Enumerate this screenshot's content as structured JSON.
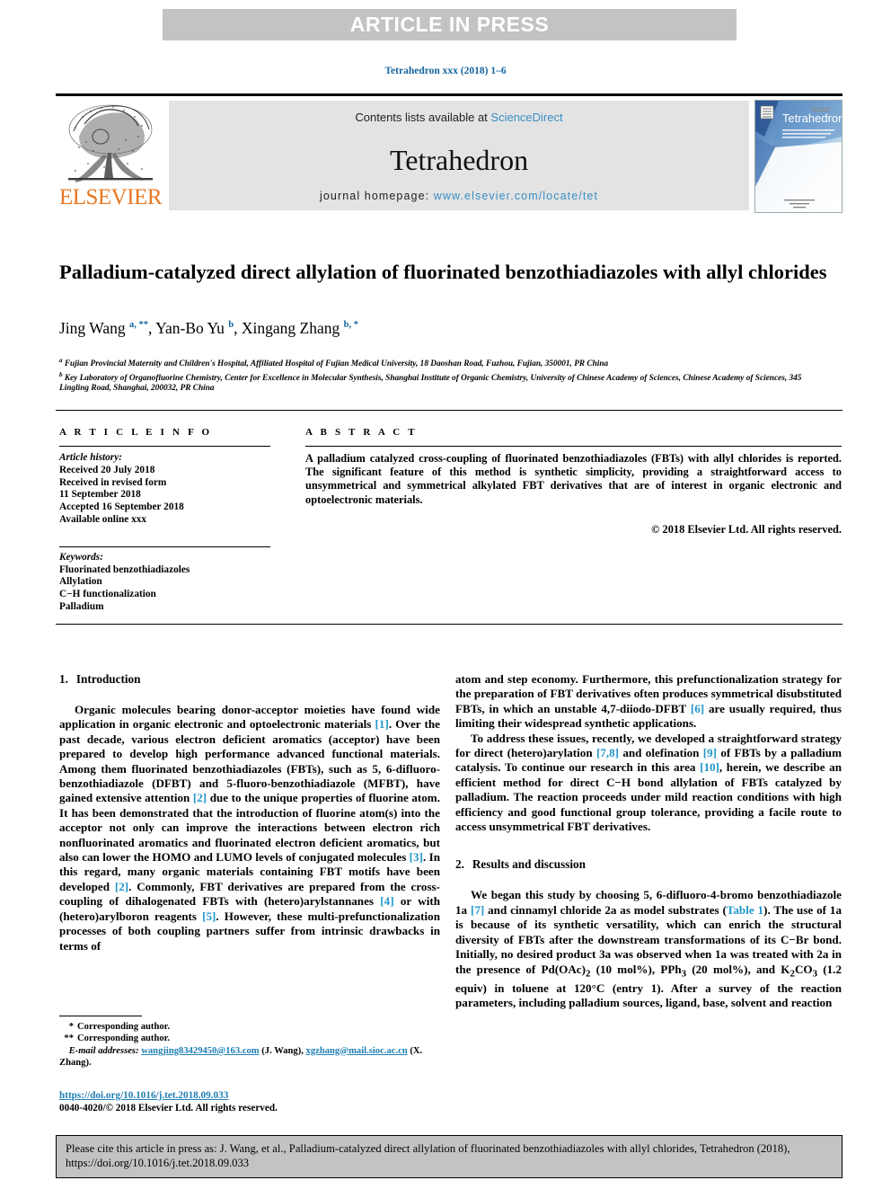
{
  "banner": {
    "text": "ARTICLE IN PRESS"
  },
  "journal_ref": "Tetrahedron xxx (2018) 1–6",
  "masthead": {
    "contents_prefix": "Contents lists available at ",
    "contents_link": "ScienceDirect",
    "journal_title": "Tetrahedron",
    "homepage_prefix": "journal homepage: ",
    "homepage_link": "www.elsevier.com/locate/tet",
    "publisher": "ELSEVIER",
    "cover_title": "Tetrahedron"
  },
  "article": {
    "title": "Palladium-catalyzed direct allylation of fluorinated benzothiadiazoles with allyl chlorides",
    "authors_html": "Jing Wang <sup>a, **</sup>, Yan-Bo Yu <sup>b</sup>, Xingang Zhang <sup>b, *</sup>",
    "affiliation_a": "Fujian Provincial Maternity and Children's Hospital, Affiliated Hospital of Fujian Medical University, 18 Daoshan Road, Fuzhou, Fujian, 350001, PR China",
    "affiliation_b": "Key Laboratory of Organofluorine Chemistry, Center for Excellence in Molecular Synthesis, Shanghai Institute of Organic Chemistry, University of Chinese Academy of Sciences, Chinese Academy of Sciences, 345 Lingling Road, Shanghai, 200032, PR China"
  },
  "article_info": {
    "heading": "A R T I C L E   I N F O",
    "history_label": "Article history:",
    "history_lines": [
      "Received 20 July 2018",
      "Received in revised form",
      "11 September 2018",
      "Accepted 16 September 2018",
      "Available online xxx"
    ],
    "keywords_label": "Keywords:",
    "keywords": [
      "Fluorinated benzothiadiazoles",
      "Allylation",
      "C−H functionalization",
      "Palladium"
    ]
  },
  "abstract": {
    "heading": "A B S T R A C T",
    "text": "A palladium catalyzed cross-coupling of fluorinated benzothiadiazoles (FBTs) with allyl chlorides is reported. The significant feature of this method is synthetic simplicity, providing a straightforward access to unsymmetrical and symmetrical alkylated FBT derivatives that are of interest in organic electronic and optoelectronic materials.",
    "copyright": "© 2018 Elsevier Ltd. All rights reserved."
  },
  "sections": {
    "intro_num": "1.",
    "intro_title": "Introduction",
    "results_num": "2.",
    "results_title": "Results and discussion"
  },
  "body": {
    "left_p1_a": "Organic molecules bearing donor-acceptor moieties have found wide application in organic electronic and optoelectronic materials ",
    "left_p1_r1": "[1]",
    "left_p1_b": ". Over the past decade, various electron deficient aromatics (acceptor) have been prepared to develop high performance advanced functional materials. Among them fluorinated benzothiadiazoles (FBTs), such as 5, 6-difluoro-benzothiadiazole (DFBT) and 5-fluoro-benzothiadiazole (MFBT), have gained extensive attention ",
    "left_p1_r2": "[2]",
    "left_p1_c": " due to the unique properties of fluorine atom. It has been demonstrated that the introduction of fluorine atom(s) into the acceptor not only can improve the interactions between electron rich nonfluorinated aromatics and fluorinated electron deficient aromatics, but also can lower the HOMO and LUMO levels of conjugated molecules ",
    "left_p1_r3": "[3]",
    "left_p1_d": ". In this regard, many organic materials containing FBT motifs have been developed ",
    "left_p1_r4": "[2]",
    "left_p1_e": ". Commonly, FBT derivatives are prepared from the cross-coupling of dihalogenated FBTs with (hetero)arylstannanes ",
    "left_p1_r5": "[4]",
    "left_p1_f": " or with (hetero)arylboron reagents ",
    "left_p1_r6": "[5]",
    "left_p1_g": ". However, these multi-prefunctionalization processes of both coupling partners suffer from intrinsic drawbacks in terms of",
    "right_p1_a": "atom and step economy. Furthermore, this prefunctionalization strategy for the preparation of FBT derivatives often produces symmetrical disubstituted FBTs, in which an unstable 4,7-diiodo-DFBT ",
    "right_p1_r1": "[6]",
    "right_p1_b": " are usually required, thus limiting their widespread synthetic applications.",
    "right_p2_a": "To address these issues, recently, we developed a straightforward strategy for direct (hetero)arylation ",
    "right_p2_r1": "[7,8]",
    "right_p2_b": " and olefination ",
    "right_p2_r2": "[9]",
    "right_p2_c": " of FBTs by a palladium catalysis. To continue our research in this area ",
    "right_p2_r3": "[10]",
    "right_p2_d": ", herein, we describe an efficient method for direct C−H bond allylation of FBTs catalyzed by palladium. The reaction proceeds under mild reaction conditions with high efficiency and good functional group tolerance, providing a facile route to access unsymmetrical FBT derivatives.",
    "right_p3_a": "We began this study by choosing 5, 6-difluoro-4-bromo benzothiadiazole ",
    "right_p3_b1": "1a",
    "right_p3_b": " ",
    "right_p3_r1": "[7]",
    "right_p3_c": " and cinnamyl chloride ",
    "right_p3_b2": "2a",
    "right_p3_d": " as model substrates (",
    "right_p3_r2": "Table 1",
    "right_p3_e": "). The use of ",
    "right_p3_b3": "1a",
    "right_p3_f": " is because of its synthetic versatility, which can enrich the structural diversity of FBTs after the downstream transformations of its C−Br bond. Initially, no desired product ",
    "right_p3_b4": "3a",
    "right_p3_g": " was observed when ",
    "right_p3_b5": "1a",
    "right_p3_h": " was treated with ",
    "right_p3_b6": "2a",
    "right_p3_i": " in the presence of Pd(OAc)",
    "right_p3_sub1": "2",
    "right_p3_j": " (10 mol%), PPh",
    "right_p3_sub2": "3",
    "right_p3_k": " (20 mol%), and K",
    "right_p3_sub3": "2",
    "right_p3_l": "CO",
    "right_p3_sub4": "3",
    "right_p3_m": " (1.2 equiv) in toluene at 120°C (entry 1). After a survey of the reaction parameters, including palladium sources, ligand, base, solvent and reaction"
  },
  "footnotes": {
    "corr1_mark": "*",
    "corr1_text": "Corresponding author.",
    "corr2_mark": "**",
    "corr2_text": "Corresponding author.",
    "email_label": "E-mail addresses:",
    "email1": "wangjing83429450@163.com",
    "email1_owner": "(J. Wang),",
    "email2": "xgzhang@mail.sioc.ac.cn",
    "email2_owner": "(X. Zhang).",
    "doi": "https://doi.org/10.1016/j.tet.2018.09.033",
    "issn_line": "0040-4020/© 2018 Elsevier Ltd. All rights reserved."
  },
  "cite_footer": {
    "text": "Please cite this article in press as: J. Wang, et al., Palladium-catalyzed direct allylation of fluorinated benzothiadiazoles with allyl chlorides, Tetrahedron (2018), https://doi.org/10.1016/j.tet.2018.09.033"
  },
  "colors": {
    "link": "#1f7fb5",
    "ref": "#2196c9",
    "elsevier_orange": "#e87722",
    "banner_gray": "#c3c3c3",
    "masthead_gray": "#e3e3e3"
  }
}
